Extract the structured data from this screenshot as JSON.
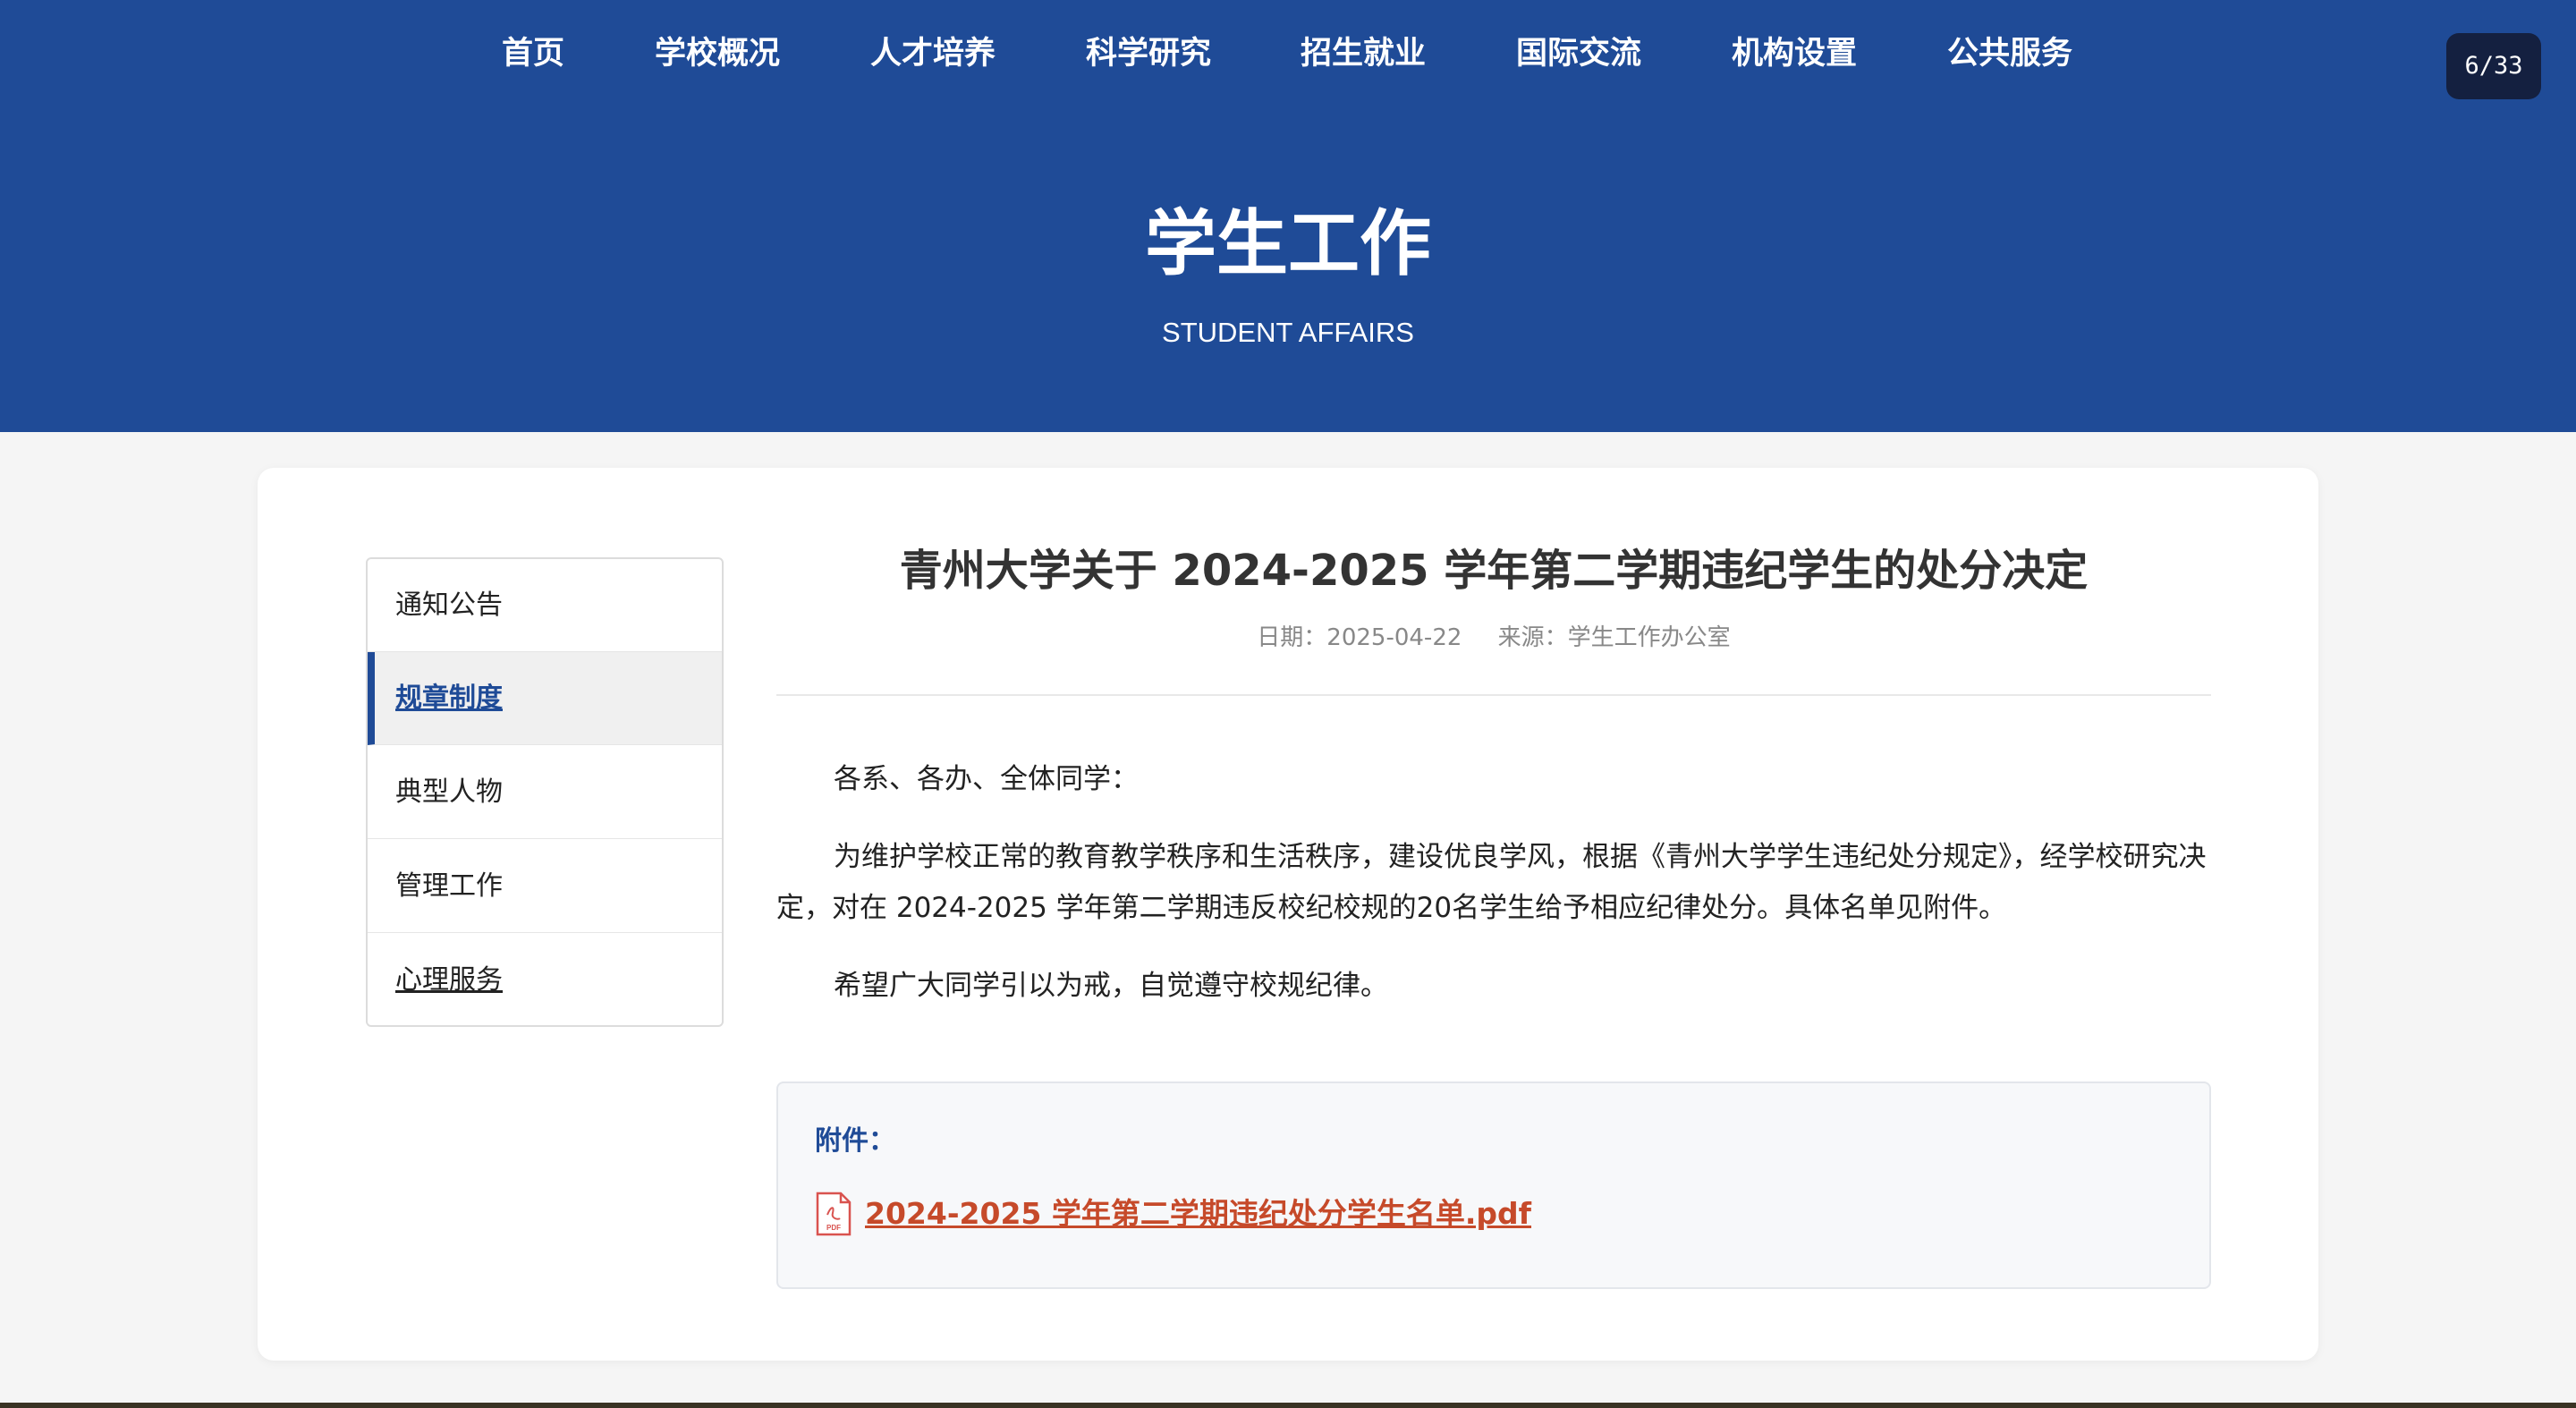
{
  "nav": {
    "items": [
      {
        "label": "首页"
      },
      {
        "label": "学校概况"
      },
      {
        "label": "人才培养"
      },
      {
        "label": "科学研究"
      },
      {
        "label": "招生就业"
      },
      {
        "label": "国际交流"
      },
      {
        "label": "机构设置"
      },
      {
        "label": "公共服务"
      }
    ]
  },
  "page_counter": "6/33",
  "hero": {
    "title": "学生工作",
    "subtitle": "STUDENT AFFAIRS"
  },
  "sidebar": {
    "items": [
      {
        "label": "通知公告",
        "active": false
      },
      {
        "label": "规章制度",
        "active": true
      },
      {
        "label": "典型人物",
        "active": false
      },
      {
        "label": "管理工作",
        "active": false
      },
      {
        "label": "心理服务",
        "active": false
      }
    ]
  },
  "article": {
    "title": "青州大学关于 2024-2025 学年第二学期违纪学生的处分决定",
    "date": "日期：2025-04-22",
    "source": "来源：学生工作办公室",
    "paragraphs": [
      "各系、各办、全体同学：",
      "为维护学校正常的教育教学秩序和生活秩序，建设优良学风，根据《青州大学学生违纪处分规定》，经学校研究决定，对在 2024-2025 学年第二学期违反校纪校规的20名学生给予相应纪律处分。具体名单见附件。",
      "希望广大同学引以为戒，自觉遵守校规纪律。"
    ]
  },
  "attachment": {
    "label": "附件：",
    "icon": "pdf-file-icon",
    "icon_text": "PDF",
    "filename": "2024-2025 学年第二学期违纪处分学生名单.pdf"
  },
  "colors": {
    "header_bg": "#1f4b97",
    "accent": "#1f4b97",
    "link": "#c64a2a"
  }
}
